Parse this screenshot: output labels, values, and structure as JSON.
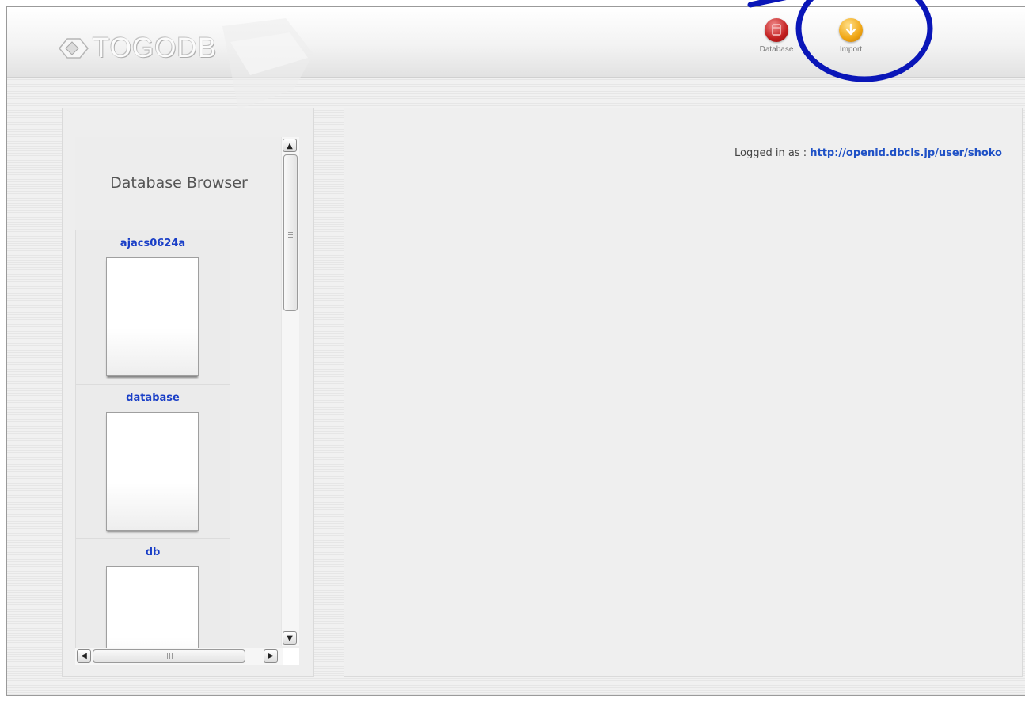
{
  "header": {
    "logo_text": "TOGODB",
    "toolbar": [
      {
        "label": "Database",
        "icon": "database-icon",
        "color": "#c21f1f"
      },
      {
        "label": "Import",
        "icon": "import-icon",
        "color": "#f0a614"
      }
    ]
  },
  "sidebar": {
    "title": "Database Browser",
    "databases": [
      {
        "name": "ajacs0624a"
      },
      {
        "name": "database"
      },
      {
        "name": "db"
      }
    ]
  },
  "main": {
    "login_label": "Logged in as : ",
    "login_user": "http://openid.dbcls.jp/user/shoko"
  },
  "colors": {
    "link": "#1f51c6",
    "annotation": "#0a16b8"
  }
}
